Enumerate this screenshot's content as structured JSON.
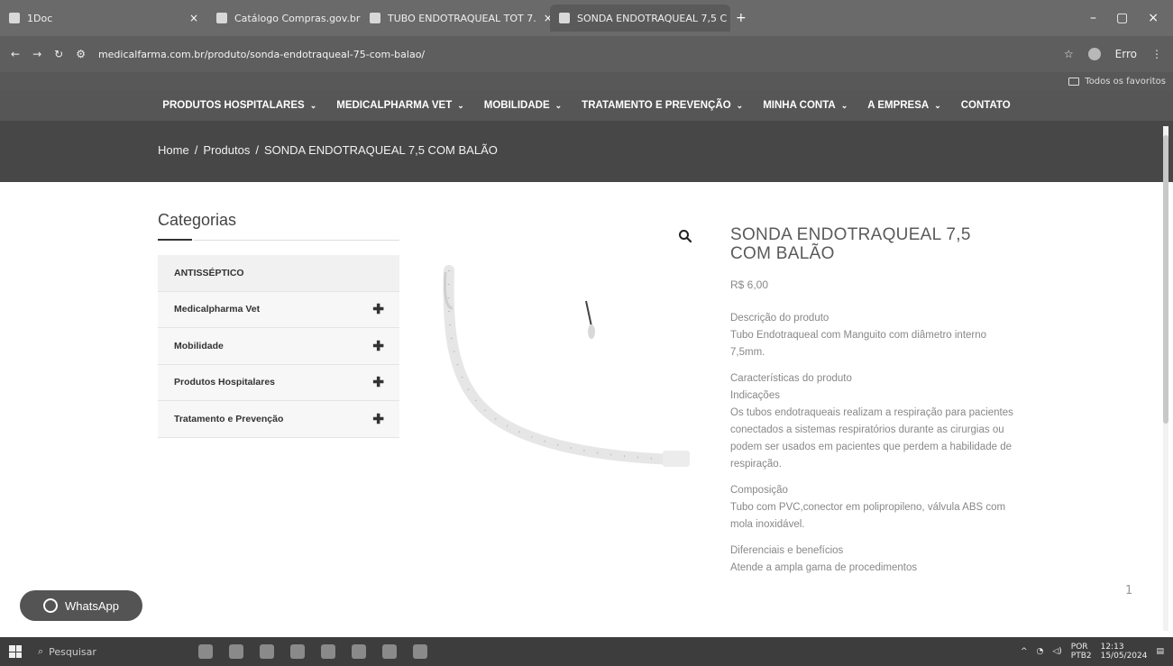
{
  "browser": {
    "tabs": [
      {
        "title": "1Doc"
      },
      {
        "title": "Catálogo Compras.gov.br"
      },
      {
        "title": "TUBO ENDOTRAQUEAL TOT 7."
      },
      {
        "title": "SONDA ENDOTRAQUEAL 7,5 C"
      }
    ],
    "url": "medicalfarma.com.br/produto/sonda-endotraqueal-75-com-balao/",
    "profile_label": "Erro",
    "bookmarks_label": "Todos os favoritos"
  },
  "nav": {
    "items": [
      {
        "label": "PRODUTOS HOSPITALARES",
        "has_menu": true
      },
      {
        "label": "MEDICALPHARMA VET",
        "has_menu": true
      },
      {
        "label": "MOBILIDADE",
        "has_menu": true
      },
      {
        "label": "TRATAMENTO E PREVENÇÃO",
        "has_menu": true
      },
      {
        "label": "MINHA CONTA",
        "has_menu": true
      },
      {
        "label": "A EMPRESA",
        "has_menu": true
      },
      {
        "label": "CONTATO",
        "has_menu": false
      }
    ]
  },
  "breadcrumb": {
    "home": "Home",
    "sep": "/",
    "products": "Produtos",
    "current": "SONDA ENDOTRAQUEAL 7,5 COM BALÃO"
  },
  "sidebar": {
    "title": "Categorias",
    "items": [
      {
        "label": "ANTISSÉPTICO",
        "expandable": false
      },
      {
        "label": "Medicalpharma Vet",
        "expandable": true
      },
      {
        "label": "Mobilidade",
        "expandable": true
      },
      {
        "label": "Produtos Hospitalares",
        "expandable": true
      },
      {
        "label": "Tratamento e Prevenção",
        "expandable": true
      }
    ]
  },
  "product": {
    "title": "SONDA ENDOTRAQUEAL 7,5 COM BALÃO",
    "price": "R$ 6,00",
    "desc_heading": "Descrição do produto",
    "desc_text": "Tubo Endotraqueal com Manguito com diâmetro interno 7,5mm.",
    "char_heading": "Características do produto",
    "indications_heading": "Indicações",
    "indications_text": "Os tubos endotraqueais realizam a respiração para pacientes conectados a sistemas respiratórios durante as cirurgias ou podem ser usados em pacientes que perdem a habilidade de respiração.",
    "composition_heading": "Composição",
    "composition_text": "Tubo com PVC,conector em polipropileno, válvula ABS com mola inoxidável.",
    "benefits_heading": "Diferenciais e benefícios",
    "benefits_text": "Atende a ampla gama de procedimentos"
  },
  "whatsapp": {
    "label": "WhatsApp"
  },
  "scroll_indicator": "1",
  "taskbar": {
    "search_placeholder": "Pesquisar",
    "lang": "POR",
    "layout": "PTB2",
    "time": "12:13",
    "date": "15/05/2024"
  }
}
